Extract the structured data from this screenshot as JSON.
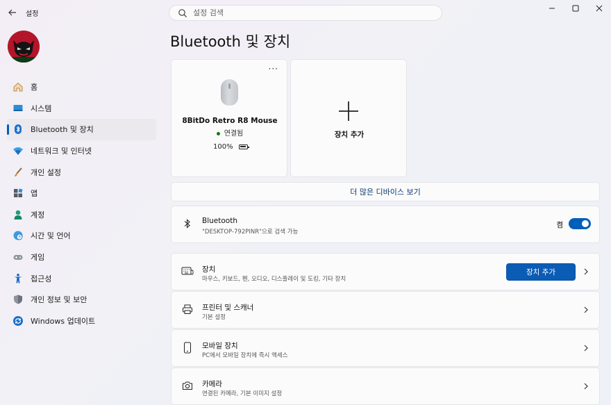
{
  "window": {
    "title": "설정",
    "back_icon": "back-arrow-icon",
    "controls": [
      "minimize-icon",
      "maximize-icon",
      "close-icon"
    ]
  },
  "search": {
    "placeholder": "설정 검색"
  },
  "nav": {
    "items": [
      {
        "label": "홈",
        "icon": "home-icon"
      },
      {
        "label": "시스템",
        "icon": "system-icon"
      },
      {
        "label": "Bluetooth 및 장치",
        "icon": "bluetooth-icon",
        "active": true
      },
      {
        "label": "네트워크 및 인터넷",
        "icon": "network-icon"
      },
      {
        "label": "개인 설정",
        "icon": "brush-icon"
      },
      {
        "label": "앱",
        "icon": "apps-icon"
      },
      {
        "label": "계정",
        "icon": "account-icon"
      },
      {
        "label": "시간 및 언어",
        "icon": "globe-clock-icon"
      },
      {
        "label": "게임",
        "icon": "gamepad-icon"
      },
      {
        "label": "접근성",
        "icon": "accessibility-icon"
      },
      {
        "label": "개인 정보 및 보안",
        "icon": "shield-icon"
      },
      {
        "label": "Windows 업데이트",
        "icon": "update-icon"
      }
    ],
    "accent": "#005fb8"
  },
  "page": {
    "title": "Bluetooth 및 장치"
  },
  "device_card": {
    "name": "8BitDo Retro R8 Mouse",
    "status": "연결됨",
    "battery": "100%",
    "more": "···"
  },
  "add_card": {
    "label": "장치 추가"
  },
  "more_devices": {
    "label": "더 많은 디바이스 보기"
  },
  "bluetooth_row": {
    "title": "Bluetooth",
    "subtitle": "\"DESKTOP-792PINR\"으로 검색 가능",
    "toggle_label": "켬",
    "toggle_on": true
  },
  "devices_row": {
    "title": "장치",
    "subtitle": "마우스, 키보드, 펜, 오디오, 디스플레이 및 도킹, 기타 장치",
    "button": "장치 추가"
  },
  "printers_row": {
    "title": "프린터 및 스캐너",
    "subtitle": "기본 설정"
  },
  "mobile_row": {
    "title": "모바일 장치",
    "subtitle": "PC에서 모바일 장치에 즉시 액세스"
  },
  "camera_row": {
    "title": "카메라",
    "subtitle": "연결된 카메라, 기본 이미지 설정"
  }
}
